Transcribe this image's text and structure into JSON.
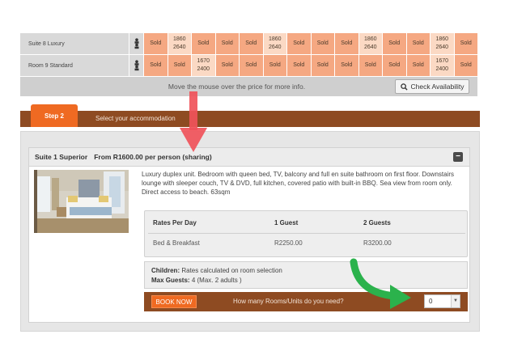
{
  "availability": {
    "rows": [
      {
        "room": "Suite 8 Luxury",
        "cells": [
          {
            "type": "sold",
            "text": "Sold"
          },
          {
            "type": "price",
            "line1": "1860",
            "line2": "2640"
          },
          {
            "type": "sold",
            "text": "Sold"
          },
          {
            "type": "sold",
            "text": "Sold"
          },
          {
            "type": "sold",
            "text": "Sold"
          },
          {
            "type": "price",
            "line1": "1860",
            "line2": "2640"
          },
          {
            "type": "sold",
            "text": "Sold"
          },
          {
            "type": "sold",
            "text": "Sold"
          },
          {
            "type": "sold",
            "text": "Sold"
          },
          {
            "type": "price",
            "line1": "1860",
            "line2": "2640"
          },
          {
            "type": "sold",
            "text": "Sold"
          },
          {
            "type": "sold",
            "text": "Sold"
          },
          {
            "type": "price",
            "line1": "1860",
            "line2": "2640"
          },
          {
            "type": "sold",
            "text": "Sold"
          }
        ]
      },
      {
        "room": "Room 9 Standard",
        "cells": [
          {
            "type": "sold",
            "text": "Sold"
          },
          {
            "type": "sold",
            "text": "Sold"
          },
          {
            "type": "price",
            "line1": "1670",
            "line2": "2400"
          },
          {
            "type": "sold",
            "text": "Sold"
          },
          {
            "type": "sold",
            "text": "Sold"
          },
          {
            "type": "sold",
            "text": "Sold"
          },
          {
            "type": "sold",
            "text": "Sold"
          },
          {
            "type": "sold",
            "text": "Sold"
          },
          {
            "type": "sold",
            "text": "Sold"
          },
          {
            "type": "sold",
            "text": "Sold"
          },
          {
            "type": "sold",
            "text": "Sold"
          },
          {
            "type": "sold",
            "text": "Sold"
          },
          {
            "type": "price",
            "line1": "1670",
            "line2": "2400"
          },
          {
            "type": "sold",
            "text": "Sold"
          }
        ]
      }
    ],
    "hint": "Move the mouse over the price for more info.",
    "check_button": "Check Availability"
  },
  "step": {
    "tab": "Step 2",
    "label": "Select your accommodation"
  },
  "suite": {
    "title": "Suite 1 Superior",
    "from_price": "From R1600.00 per person (sharing)",
    "collapse_symbol": "−",
    "description": "Luxury duplex unit. Bedroom with queen bed, TV, balcony and full en suite bathroom on first floor. Downstairs lounge with sleeper couch, TV & DVD, full kitchen, covered patio with built-in BBQ. Sea view from room only. Direct access to beach. 63sqm",
    "rates": {
      "headers": [
        "Rates Per Day",
        "1 Guest",
        "2 Guests"
      ],
      "rows": [
        [
          "Bed & Breakfast",
          "R2250.00",
          "R3200.00"
        ]
      ]
    },
    "children_label": "Children:",
    "children_value": "Rates calculated on room selection",
    "max_guests_label": "Max Guests:",
    "max_guests_value": "4  (Max. 2 adults )",
    "book_button": "BOOK NOW",
    "rooms_question": "How many Rooms/Units do you need?",
    "rooms_selected": "0"
  },
  "colors": {
    "sold": "#f5a882",
    "price": "#fbd9c4",
    "brown": "#8e4b22",
    "orange": "#ef6a22",
    "red_arrow": "#f0525a",
    "green_arrow": "#2bb24c"
  },
  "icons": {
    "guests": "people-icon",
    "check": "search-icon",
    "collapse": "minus-icon",
    "dropdown": "chevron-down-icon"
  }
}
